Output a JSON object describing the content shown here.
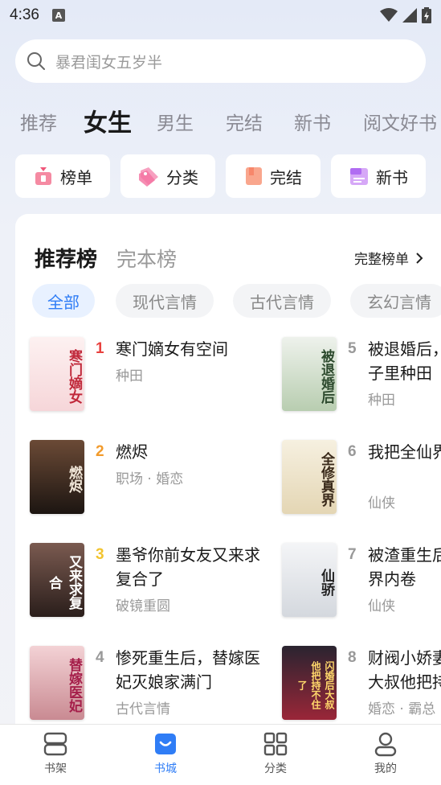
{
  "status": {
    "time": "4:36",
    "notif_letter": "A"
  },
  "search": {
    "placeholder": "暴君闺女五岁半"
  },
  "tabs": [
    {
      "label": "推荐"
    },
    {
      "label": "女生"
    },
    {
      "label": "男生"
    },
    {
      "label": "完结"
    },
    {
      "label": "新书"
    },
    {
      "label": "阅文好书"
    }
  ],
  "quick": [
    {
      "label": "榜单",
      "icon": "ranking-icon",
      "color": "#f0577a"
    },
    {
      "label": "分类",
      "icon": "tag-icon",
      "color": "#f472a0"
    },
    {
      "label": "完结",
      "icon": "book-complete-icon",
      "color": "#f7876b"
    },
    {
      "label": "新书",
      "icon": "new-book-icon",
      "color": "#b06cf2"
    }
  ],
  "rank": {
    "tabs": [
      {
        "label": "推荐榜"
      },
      {
        "label": "完本榜"
      }
    ],
    "full_list": "完整榜单",
    "chips": [
      {
        "label": "全部"
      },
      {
        "label": "现代言情"
      },
      {
        "label": "古代言情"
      },
      {
        "label": "玄幻言情"
      }
    ],
    "books": [
      {
        "rank": "1",
        "title": "寒门嫡女有空间",
        "tags": "种田",
        "cover_text": "寒门嫡女"
      },
      {
        "rank": "2",
        "title": "燃烬",
        "tags": "职场 · 婚恋",
        "cover_text": "燃烬"
      },
      {
        "rank": "3",
        "title": "墨爷你前女友又来求复合了",
        "tags": "破镜重圆",
        "cover_text": "又来求复合"
      },
      {
        "rank": "4",
        "title": "惨死重生后，替嫁医妃灭娘家满门",
        "tags": "古代言情",
        "cover_text": "替嫁医妃"
      },
      {
        "rank": "5",
        "title": "被退婚后，我在村肠子里种田",
        "tags": "种田",
        "cover_text": "被退婚后"
      },
      {
        "rank": "6",
        "title": "我把全仙界都惹哭了",
        "tags": "仙侠",
        "cover_text": "全修真界"
      },
      {
        "rank": "7",
        "title": "被渣重生后，我在仙界内卷",
        "tags": "仙侠",
        "cover_text": "仙骄"
      },
      {
        "rank": "8",
        "title": "财阀小娇妻重生后，大叔他把持不住了",
        "tags": "婚恋 · 霸总",
        "cover_text": "闪婚后大叔他把持不住了"
      }
    ]
  },
  "nav": [
    {
      "label": "书架"
    },
    {
      "label": "书城"
    },
    {
      "label": "分类"
    },
    {
      "label": "我的"
    }
  ],
  "colors": {
    "accent": "#2f7df6",
    "rank1": "#e8413e",
    "rank2": "#f29b2c",
    "rank3": "#f2c430",
    "rank_other": "#999999"
  }
}
